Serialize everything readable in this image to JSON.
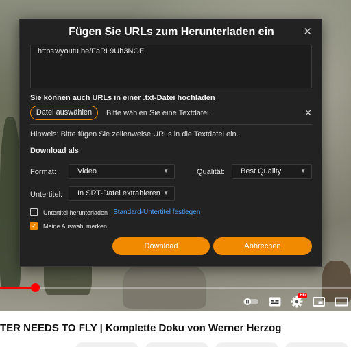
{
  "video": {
    "title": "TER NEEDS TO FLY | Komplette Doku von Werner Herzog",
    "progress_percent": 10,
    "hd_badge": "HD"
  },
  "controls": {
    "icons": [
      "autoplay-toggle-icon",
      "subtitles-icon",
      "settings-icon",
      "miniplayer-icon",
      "theater-mode-icon"
    ]
  },
  "dialog": {
    "title": "Fügen Sie URLs zum Herunterladen ein",
    "close_icon": "close-icon",
    "url_text": "https://youtu.be/FaRL9Uh3NGE",
    "upload_heading": "Sie können auch URLs in einer .txt-Datei hochladen",
    "file_button": "Datei auswählen",
    "file_status": "Bitte wählen Sie eine Textdatei.",
    "hint": "Hinweis: Bitte fügen Sie zeilenweise URLs in die Textdatei ein.",
    "download_as": "Download als",
    "format_label": "Format:",
    "format_value": "Video",
    "quality_label": "Qualität:",
    "quality_value": "Best Quality",
    "subtitle_label": "Untertitel:",
    "subtitle_value": "In SRT-Datei extrahieren",
    "cb_subtitles_label": "Untertitel herunterladen",
    "cb_subtitles_checked": false,
    "cb_subtitles_link": "Standard-Untertitel festlegen",
    "cb_remember_label": "Meine Auswahl merken",
    "cb_remember_checked": true,
    "download_button": "Download",
    "cancel_button": "Abbrechen"
  },
  "colors": {
    "accent": "#f28a00",
    "dialog_bg": "#222222",
    "link": "#4aa3ff",
    "progress": "#ff0000"
  }
}
